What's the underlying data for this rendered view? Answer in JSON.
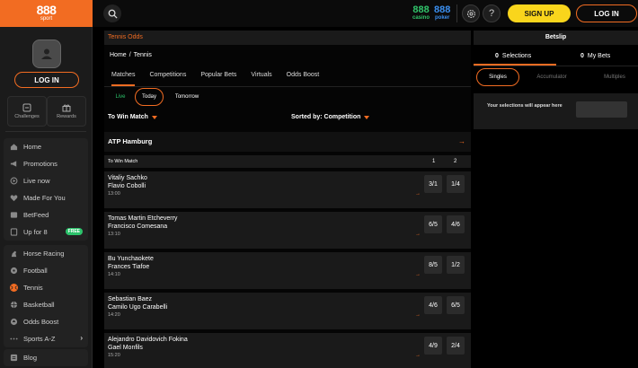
{
  "brand": {
    "logo": "888",
    "logo_sub": "sport"
  },
  "topbar": {
    "casino": {
      "num": "888",
      "name": "casino"
    },
    "poker": {
      "num": "888",
      "name": "poker"
    },
    "help_label": "?",
    "signup_label": "SIGN UP",
    "login_label": "LOG IN"
  },
  "sidebar": {
    "login_label": "LOG IN",
    "quick": [
      {
        "label": "Challenges"
      },
      {
        "label": "Rewards"
      }
    ],
    "group1": [
      {
        "label": "Home",
        "icon": "home-icon"
      },
      {
        "label": "Promotions",
        "icon": "megaphone-icon"
      },
      {
        "label": "Live now",
        "icon": "live-icon"
      },
      {
        "label": "Made For You",
        "icon": "heart-icon"
      },
      {
        "label": "BetFeed",
        "icon": "feed-icon"
      },
      {
        "label": "Up for 8",
        "icon": "prize-icon",
        "badge": "FREE"
      }
    ],
    "group2": [
      {
        "label": "Horse Racing",
        "icon": "horse-icon"
      },
      {
        "label": "Football",
        "icon": "football-icon"
      },
      {
        "label": "Tennis",
        "icon": "tennis-icon",
        "active": true
      },
      {
        "label": "Basketball",
        "icon": "basketball-icon"
      },
      {
        "label": "Odds Boost",
        "icon": "boost-icon"
      },
      {
        "label": "Sports A-Z",
        "icon": "dots-icon",
        "chevron": "›"
      }
    ],
    "group3": [
      {
        "label": "Blog",
        "icon": "blog-icon"
      }
    ]
  },
  "main": {
    "header": "Tennis Odds",
    "breadcrumb": {
      "home": "Home",
      "sep": "/",
      "current": "Tennis"
    },
    "tabs": [
      "Matches",
      "Competitions",
      "Popular Bets",
      "Virtuals",
      "Odds Boost"
    ],
    "filters": [
      "Live",
      "Today",
      "Tomorrow"
    ],
    "market_select": "To Win Match",
    "sort_label": "Sorted by: Competition",
    "tournament": "ATP Hamburg",
    "tournament_arrow": "→",
    "market_row": {
      "label": "To Win Match",
      "col1": "1",
      "col2": "2"
    },
    "matches": [
      {
        "p1": "Vitaliy Sachko",
        "p2": "Flavio Cobolli",
        "time": "13:00",
        "o1": "3/1",
        "o2": "1/4"
      },
      {
        "p1": "Tomas Martin Etcheverry",
        "p2": "Francisco Comesana",
        "time": "13:10",
        "o1": "6/5",
        "o2": "4/6"
      },
      {
        "p1": "Bu Yunchaokete",
        "p2": "Frances Tiafoe",
        "time": "14:10",
        "o1": "8/5",
        "o2": "1/2"
      },
      {
        "p1": "Sebastian Baez",
        "p2": "Camilo Ugo Carabelli",
        "time": "14:20",
        "o1": "4/6",
        "o2": "6/5"
      },
      {
        "p1": "Alejandro Davidovich Fokina",
        "p2": "Gael Monfils",
        "time": "15:20",
        "o1": "4/9",
        "o2": "2/4"
      }
    ]
  },
  "betslip": {
    "title": "Betslip",
    "tabs": [
      {
        "num": "0",
        "label": "Selections"
      },
      {
        "num": "0",
        "label": "My Bets"
      }
    ],
    "types": [
      "Singles",
      "Accumulator",
      "Multiples"
    ],
    "empty_msg": "Your selections will appear here"
  },
  "colors": {
    "accent": "#f26c22",
    "signup": "#f9d51c",
    "casino": "#31c56b",
    "poker": "#3b8ff0",
    "free": "#2cc36b"
  }
}
